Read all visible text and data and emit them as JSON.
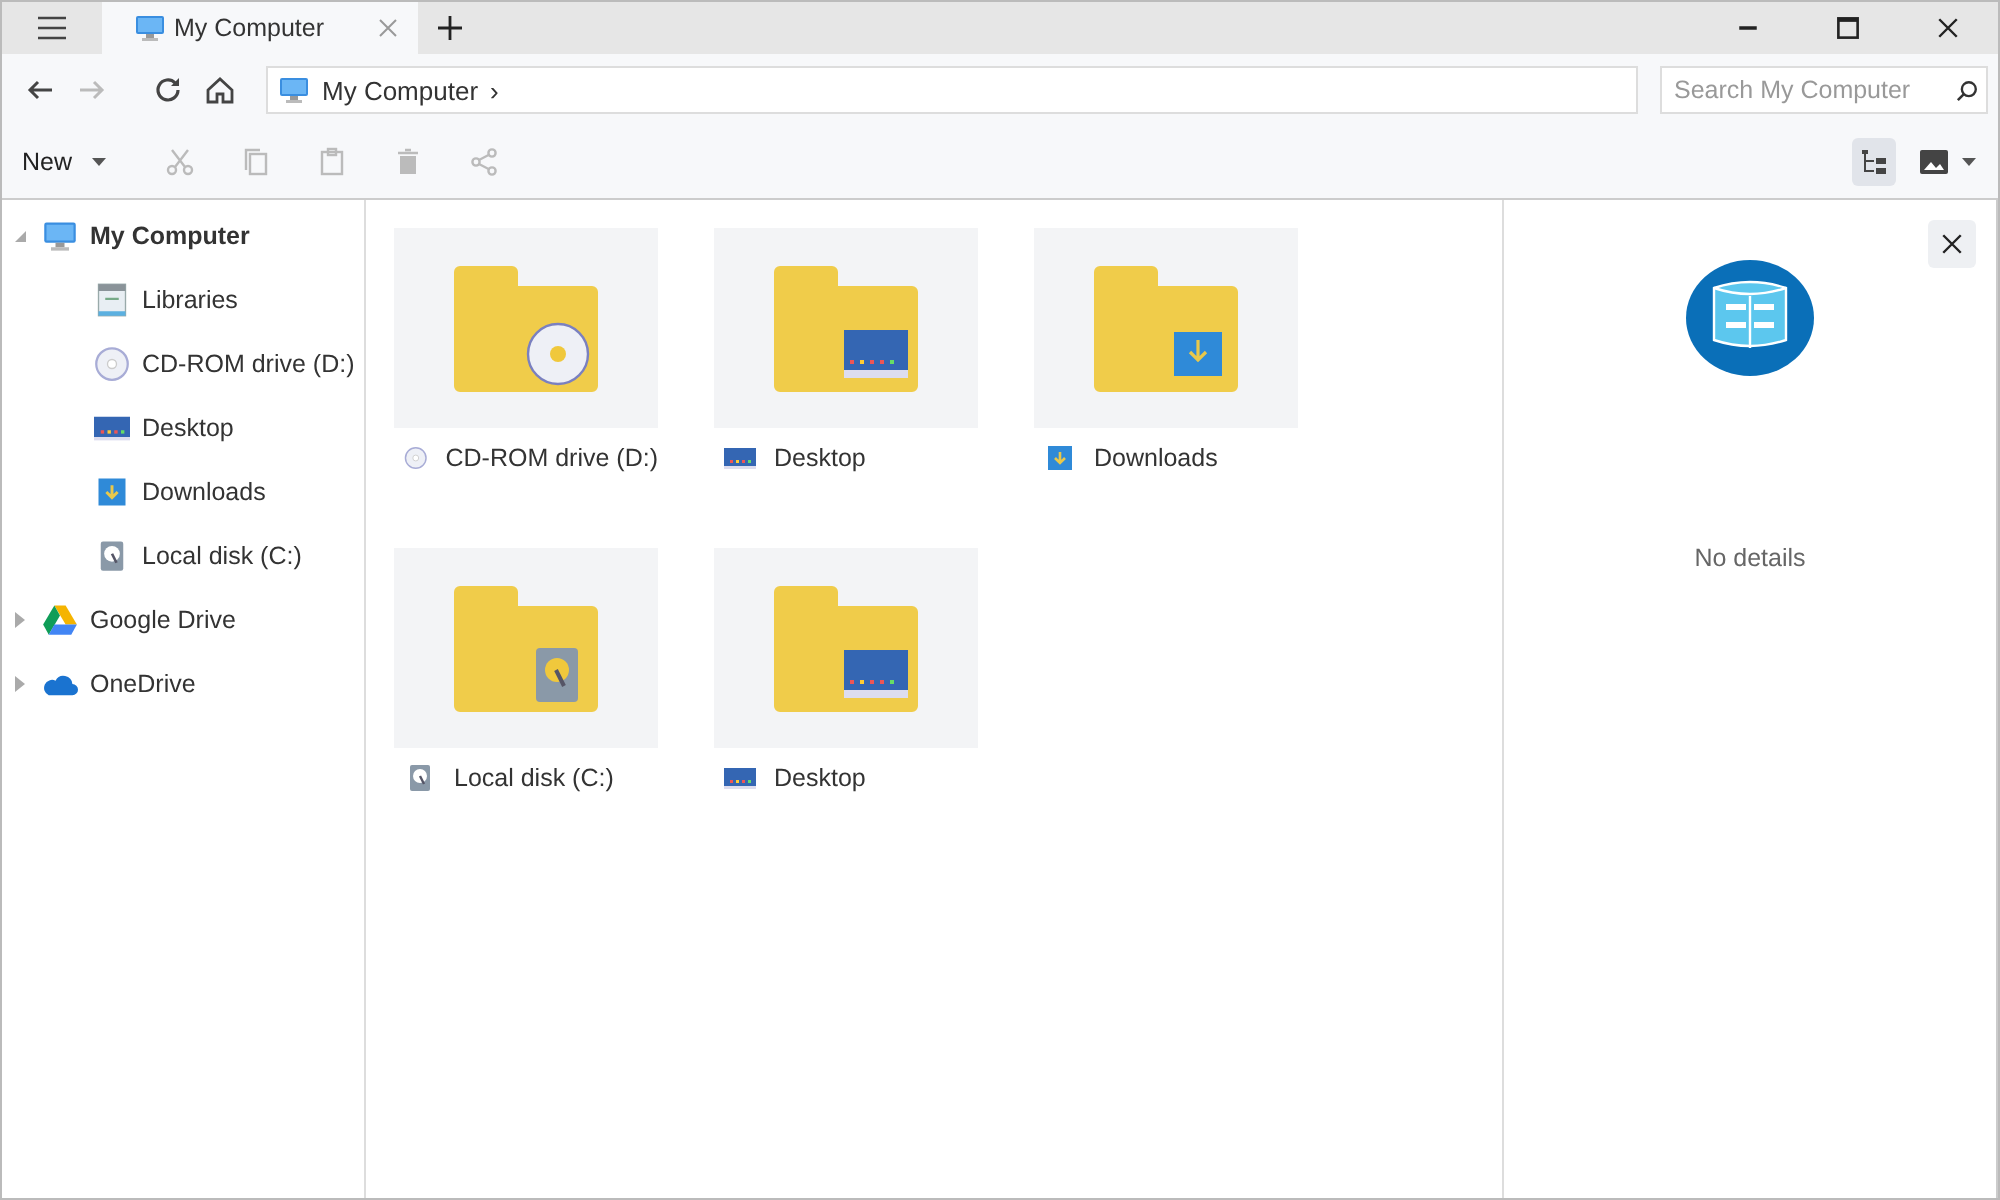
{
  "window": {
    "controls": [
      {
        "kind": "minimize"
      },
      {
        "kind": "maximize"
      },
      {
        "kind": "close"
      }
    ]
  },
  "tabs": [
    {
      "title": "My Computer",
      "kind": "computer",
      "selected": true
    }
  ],
  "nav": [
    {
      "kind": "back",
      "disabled": false
    },
    {
      "kind": "forward",
      "disabled": true
    },
    {
      "kind": "refresh",
      "disabled": false
    },
    {
      "kind": "home",
      "disabled": false
    }
  ],
  "address": {
    "kind": "computer",
    "path": "My Computer",
    "separator": "›"
  },
  "search": {
    "placeholder": "Search My Computer"
  },
  "toolbar": {
    "new_label": "New",
    "actions": [
      {
        "kind": "cut",
        "disabled": true
      },
      {
        "kind": "copy",
        "disabled": true
      },
      {
        "kind": "paste",
        "disabled": true
      },
      {
        "kind": "delete",
        "disabled": true
      },
      {
        "kind": "share",
        "disabled": true
      }
    ],
    "views": [
      {
        "kind": "tree",
        "selected": true
      },
      {
        "kind": "image",
        "selected": false
      }
    ]
  },
  "sidebar": {
    "items": [
      {
        "label": "My Computer",
        "kind": "computer",
        "selected": true,
        "expanded": true,
        "children": [
          {
            "label": "Libraries",
            "kind": "library",
            "selected": false
          },
          {
            "label": "CD-ROM drive (D:)",
            "kind": "cdrom",
            "selected": false
          },
          {
            "label": "Desktop",
            "kind": "desktop",
            "selected": false
          },
          {
            "label": "Downloads",
            "kind": "downloads",
            "selected": false
          },
          {
            "label": "Local disk (C:)",
            "kind": "disk",
            "selected": false
          }
        ]
      },
      {
        "label": "Google Drive",
        "kind": "gdrive",
        "selected": false,
        "expanded": false
      },
      {
        "label": "OneDrive",
        "kind": "onedrive",
        "selected": false,
        "expanded": false
      }
    ]
  },
  "items": [
    {
      "label": "CD-ROM drive (D:)",
      "kind": "cdrom"
    },
    {
      "label": "Desktop",
      "kind": "desktop"
    },
    {
      "label": "Downloads",
      "kind": "downloads"
    },
    {
      "label": "Local disk (C:)",
      "kind": "disk"
    },
    {
      "label": "Desktop",
      "kind": "desktop"
    }
  ],
  "details": {
    "message": "No details"
  }
}
